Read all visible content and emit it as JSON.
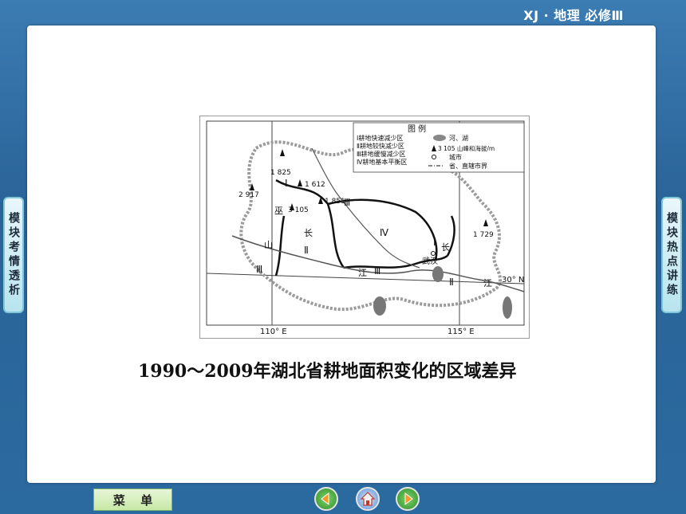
{
  "header": {
    "title": "XJ · 地理  必修Ⅲ"
  },
  "side_tabs": {
    "left_label": "模块考情透析",
    "right_label": "模块热点讲练"
  },
  "map": {
    "legend_title": "图 例",
    "legend_items": [
      "Ⅰ耕地快速减少区",
      "Ⅱ耕地较快减少区",
      "Ⅲ耕地缓慢减少区",
      "Ⅳ耕地基本平衡区"
    ],
    "legend_symbols": [
      "河、湖",
      "3 105 山峰和海拔/m",
      "城市",
      "省、直辖市界"
    ],
    "peaks": [
      "1 825",
      "1 612",
      "2 917",
      "1 851",
      "3 105",
      "1 729"
    ],
    "region_labels": [
      "Ⅰ",
      "Ⅲ",
      "Ⅱ",
      "Ⅳ",
      "Ⅰ",
      "Ⅲ",
      "Ⅲ",
      "Ⅱ"
    ],
    "place_labels": {
      "wu": "巫",
      "shan": "山",
      "chang1": "长",
      "jiang1": "江",
      "chang2": "长",
      "jiang2": "江",
      "wuhan": "武汉"
    },
    "lat_label": "30° N",
    "lon_labels": [
      "110° E",
      "115° E"
    ]
  },
  "caption": "1990～2009年湖北省耕地面积变化的区域差异",
  "footer": {
    "menu_label_1": "菜",
    "menu_label_2": "单"
  },
  "colors": {
    "background": "#2d6a9c",
    "panel": "#ffffff",
    "tab": "#b8e4ee"
  }
}
